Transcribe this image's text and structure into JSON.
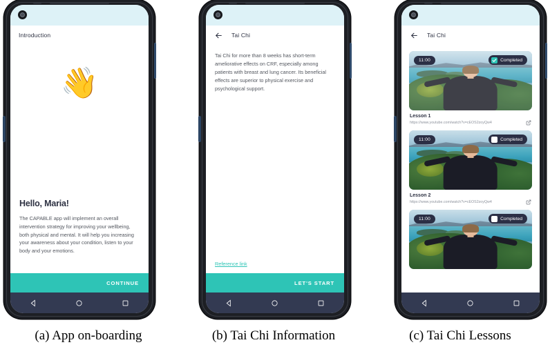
{
  "figure": {
    "captions": [
      "(a) App on-boarding",
      "(b) Tai Chi Information",
      "(c) Tai Chi Lessons"
    ]
  },
  "colors": {
    "accent_teal": "#2ec4b6",
    "status_bar_blue": "#ddf2f7",
    "nav_bar_navy": "#333a52",
    "badge_navy": "#2b2f45",
    "heading_navy": "#2d3142",
    "body_gray": "#53575f"
  },
  "screen_a": {
    "app_bar": {
      "title": "Introduction"
    },
    "emoji": "👋",
    "emoji_name": "waving-hand-emoji",
    "greeting": "Hello, Maria!",
    "paragraph": "The CAPABLE app will implement an overall intervention strategy for improving your wellbeing, both physical and mental. It will help you increasing your awareness about your condition, listen to your body and your emotions.",
    "cta_label": "CONTINUE"
  },
  "screen_b": {
    "app_bar": {
      "title": "Tai Chi",
      "back_icon": "arrow-left-icon"
    },
    "paragraph": "Tai Chi for more than 8 weeks has short-term ameliorative effects on CRF, especially among patients with breast and lung cancer. Its beneficial effects are superior to physical exercise and psychological support.",
    "reference_link": "Reference link",
    "cta_label": "LET'S START"
  },
  "screen_c": {
    "app_bar": {
      "title": "Tai Chi",
      "back_icon": "arrow-left-icon"
    },
    "lessons": [
      {
        "time": "11:00",
        "completed_label": "Completed",
        "completed": true,
        "title": "Lesson 1",
        "url": "https://www.youtube.com/watch?v=cEOS2zoyQw4",
        "open_icon": "external-link-icon"
      },
      {
        "time": "11:00",
        "completed_label": "Completed",
        "completed": false,
        "title": "Lesson 2",
        "url": "https://www.youtube.com/watch?v=cEOS2zoyQw4",
        "open_icon": "external-link-icon"
      },
      {
        "time": "11:00",
        "completed_label": "Completed",
        "completed": false,
        "title": "",
        "url": "",
        "open_icon": "external-link-icon"
      }
    ]
  },
  "nav_bar": {
    "back_icon": "triangle-back-icon",
    "home_icon": "circle-home-icon",
    "recents_icon": "square-recents-icon"
  }
}
